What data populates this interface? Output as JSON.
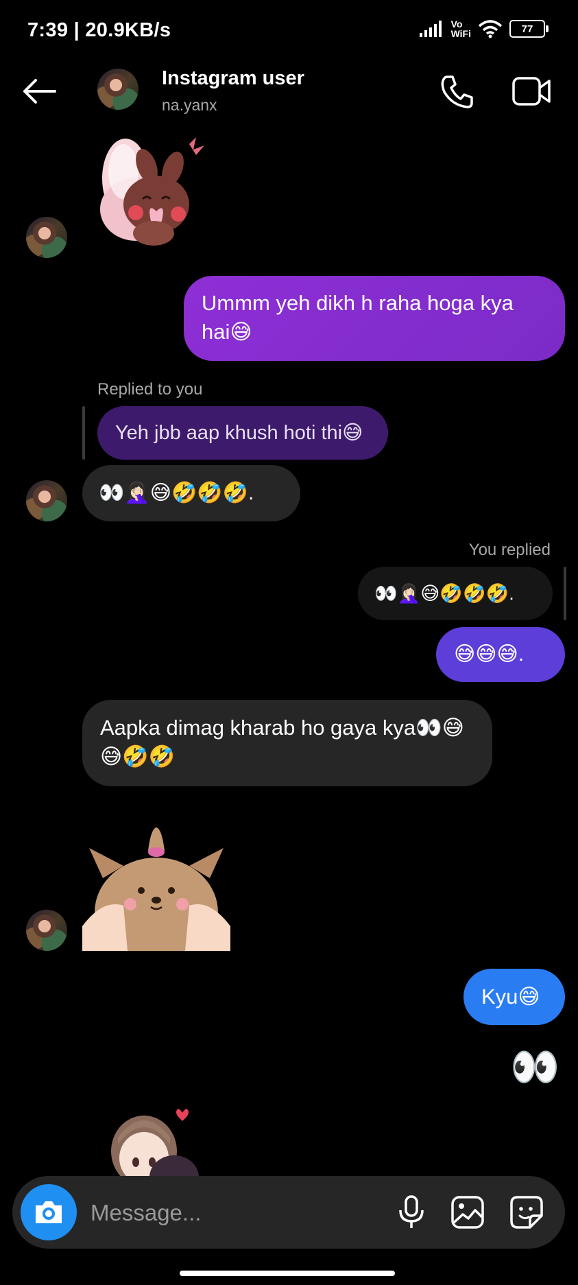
{
  "status_bar": {
    "time": "7:39 | 20.9KB/s",
    "network_label": "Vo\nWiFi",
    "battery": "77"
  },
  "header": {
    "title": "Instagram user",
    "username": "na.yanx"
  },
  "messages": [
    {
      "id": "m1",
      "text": "Ummm yeh dikh h raha hoga kya hai😅"
    },
    {
      "id": "m2",
      "reply_label": "Replied to you",
      "quoted": "Yeh jbb aap khush hoti thi😅",
      "text": "👀🤦🏻‍♀️😅🤣🤣🤣."
    },
    {
      "id": "m3",
      "reply_label": "You replied",
      "quoted": "👀🤦🏻‍♀️😅🤣🤣🤣.",
      "text": "😅😅😅."
    },
    {
      "id": "m4",
      "text": "Aapka dimag kharab ho gaya kya👀😅😅🤣🤣"
    },
    {
      "id": "m5",
      "text": "Kyu😅"
    },
    {
      "id": "m6",
      "text": "👀"
    }
  ],
  "composer": {
    "placeholder": "Message..."
  },
  "icons": {
    "back": "back-arrow-icon",
    "call": "phone-icon",
    "video": "video-camera-icon",
    "camera": "camera-icon",
    "mic": "microphone-icon",
    "gallery": "gallery-icon",
    "sticker": "sticker-icon"
  },
  "colors": {
    "sent_purple": "#8e2fd6",
    "sent_violet": "#5d3ed8",
    "sent_blue": "#2a7cf3",
    "received": "#262626",
    "camera_button": "#1f8ff2"
  }
}
